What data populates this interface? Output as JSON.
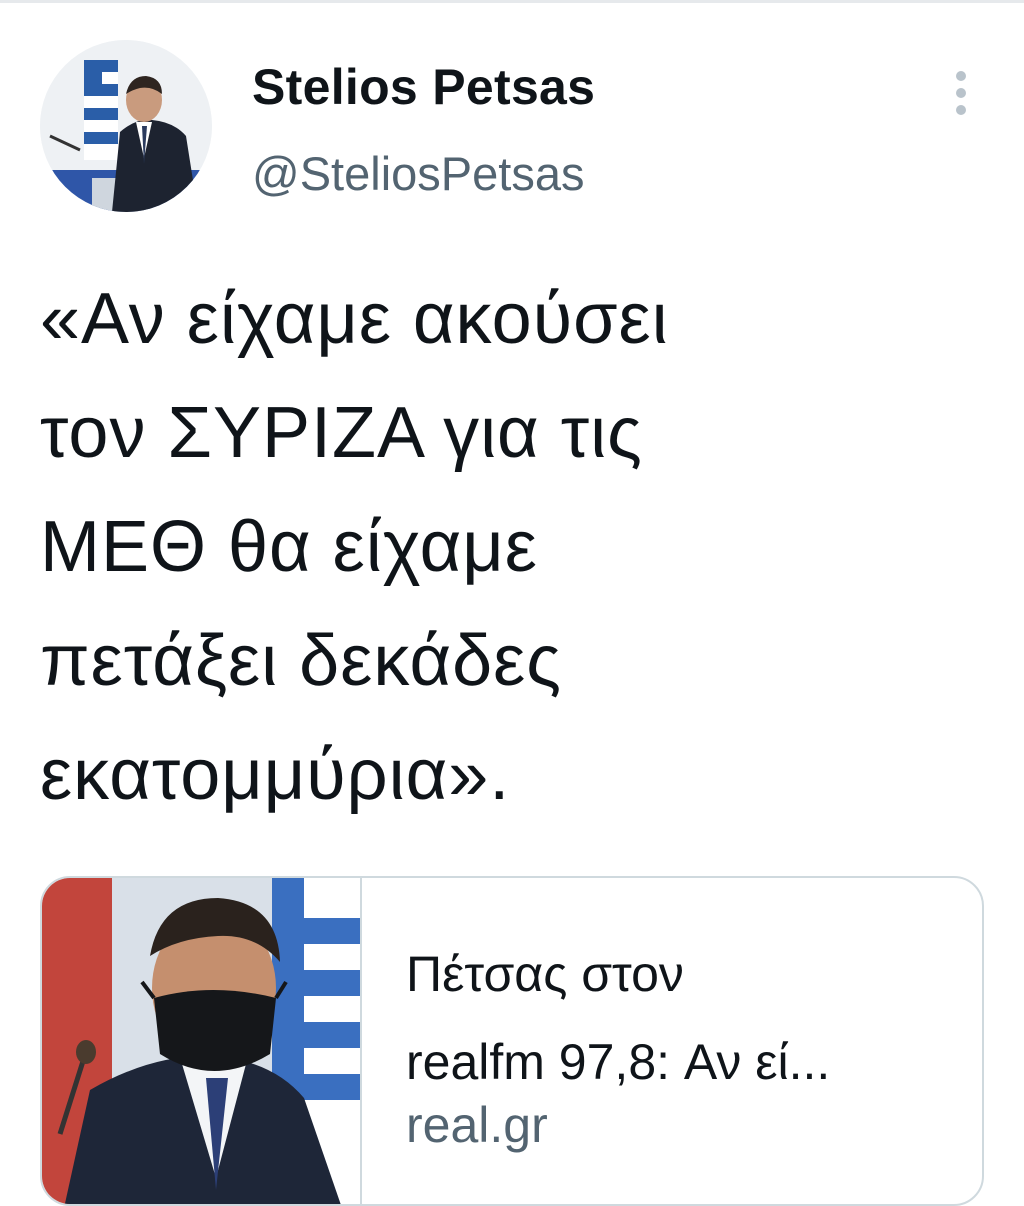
{
  "tweet": {
    "author": {
      "display_name": "Stelios Petsas",
      "handle": "@SteliosPetsas"
    },
    "more_icon": "vertical-dots-icon",
    "text": "«Αν είχαμε ακούσει\nτον ΣΥΡΙΖΑ για τις\nΜΕΘ θα είχαμε\nπετάξει δεκάδες\nεκατομμύρια».",
    "link_card": {
      "title": "Πέτσας στον\nrealfm 97,8: Αν εί...",
      "domain": "real.gr"
    }
  },
  "colors": {
    "text_primary": "#0f1419",
    "text_secondary": "#536471",
    "card_border": "#cfd9de",
    "icon_gray": "#b9c3cb"
  }
}
